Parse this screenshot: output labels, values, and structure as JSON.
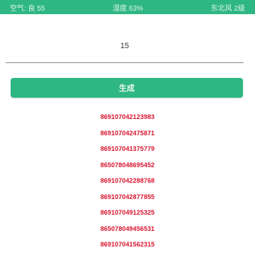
{
  "status_bar": {
    "left": "空气: 良 55",
    "center": "湿度 63%",
    "right": "东北风 2级"
  },
  "number_field": {
    "value": "15"
  },
  "action_button": {
    "label": "生成"
  },
  "list": [
    "869107042123983",
    "869107042475871",
    "869107041375779",
    "865078048695452",
    "869107042288768",
    "869107042877855",
    "869107049125325",
    "865078049456531",
    "869107041562315"
  ]
}
